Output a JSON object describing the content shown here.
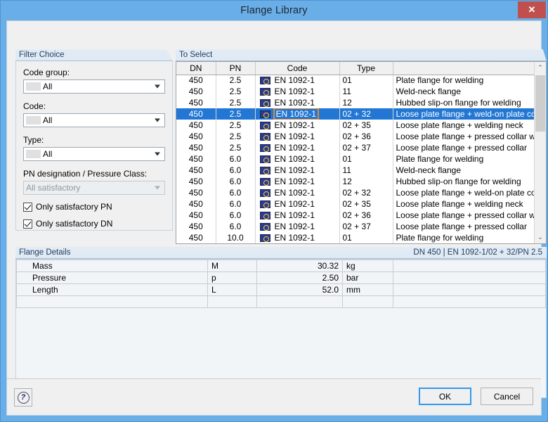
{
  "window": {
    "title": "Flange Library",
    "close_label": "✕"
  },
  "filter": {
    "group_title": "Filter Choice",
    "code_group": {
      "label": "Code group:",
      "value": "All"
    },
    "code": {
      "label": "Code:",
      "value": "All"
    },
    "type": {
      "label": "Type:",
      "value": "All"
    },
    "pn_class": {
      "label": "PN designation / Pressure Class:",
      "value": "All satisfactory"
    },
    "checkboxes": [
      {
        "label": "Only satisfactory PN",
        "checked": true
      },
      {
        "label": "Only satisfactory DN",
        "checked": true
      }
    ]
  },
  "select": {
    "group_title": "To Select",
    "columns": [
      "DN",
      "PN",
      "Code",
      "Type",
      ""
    ],
    "rows": [
      {
        "dn": "450",
        "pn": "2.5",
        "code": "EN 1092-1",
        "type": "01",
        "desc": "Plate flange for welding",
        "selected": false
      },
      {
        "dn": "450",
        "pn": "2.5",
        "code": "EN 1092-1",
        "type": "11",
        "desc": "Weld-neck flange",
        "selected": false
      },
      {
        "dn": "450",
        "pn": "2.5",
        "code": "EN 1092-1",
        "type": "12",
        "desc": "Hubbed slip-on flange for welding",
        "selected": false
      },
      {
        "dn": "450",
        "pn": "2.5",
        "code": "EN 1092-1",
        "type": "02 + 32",
        "desc": "Loose plate flange + weld-on plate collar",
        "selected": true
      },
      {
        "dn": "450",
        "pn": "2.5",
        "code": "EN 1092-1",
        "type": "02 + 35",
        "desc": "Loose plate flange + welding neck",
        "selected": false
      },
      {
        "dn": "450",
        "pn": "2.5",
        "code": "EN 1092-1",
        "type": "02 + 36",
        "desc": "Loose plate flange + pressed collar with long n",
        "selected": false
      },
      {
        "dn": "450",
        "pn": "2.5",
        "code": "EN 1092-1",
        "type": "02 + 37",
        "desc": "Loose plate flange + pressed collar",
        "selected": false
      },
      {
        "dn": "450",
        "pn": "6.0",
        "code": "EN 1092-1",
        "type": "01",
        "desc": "Plate flange for welding",
        "selected": false
      },
      {
        "dn": "450",
        "pn": "6.0",
        "code": "EN 1092-1",
        "type": "11",
        "desc": "Weld-neck flange",
        "selected": false
      },
      {
        "dn": "450",
        "pn": "6.0",
        "code": "EN 1092-1",
        "type": "12",
        "desc": "Hubbed slip-on flange for welding",
        "selected": false
      },
      {
        "dn": "450",
        "pn": "6.0",
        "code": "EN 1092-1",
        "type": "02 + 32",
        "desc": "Loose plate flange + weld-on plate collar",
        "selected": false
      },
      {
        "dn": "450",
        "pn": "6.0",
        "code": "EN 1092-1",
        "type": "02 + 35",
        "desc": "Loose plate flange + welding neck",
        "selected": false
      },
      {
        "dn": "450",
        "pn": "6.0",
        "code": "EN 1092-1",
        "type": "02 + 36",
        "desc": "Loose plate flange + pressed collar with long n",
        "selected": false
      },
      {
        "dn": "450",
        "pn": "6.0",
        "code": "EN 1092-1",
        "type": "02 + 37",
        "desc": "Loose plate flange + pressed collar",
        "selected": false
      },
      {
        "dn": "450",
        "pn": "10.0",
        "code": "EN 1092-1",
        "type": "01",
        "desc": "Plate flange for welding",
        "selected": false
      }
    ],
    "scroll_up_glyph": "⌃",
    "scroll_down_glyph": "⌄"
  },
  "details": {
    "group_title": "Flange Details",
    "summary": "DN 450 | EN 1092-1/02 + 32/PN 2.5",
    "rows": [
      {
        "name": "Mass",
        "symbol": "M",
        "value": "30.32",
        "unit": "kg"
      },
      {
        "name": "Pressure",
        "symbol": "p",
        "value": "2.50",
        "unit": "bar"
      },
      {
        "name": "Length",
        "symbol": "L",
        "value": "52.0",
        "unit": "mm"
      }
    ]
  },
  "footer": {
    "help_glyph": "?",
    "ok_label": "OK",
    "cancel_label": "Cancel"
  },
  "colors": {
    "titlebar": "#6aaee8",
    "close": "#c0504d",
    "selection": "#2277d4",
    "focus_rect": "#e08a2e",
    "group_title_text": "#1f3c5f",
    "default_button_border": "#3399ec"
  }
}
